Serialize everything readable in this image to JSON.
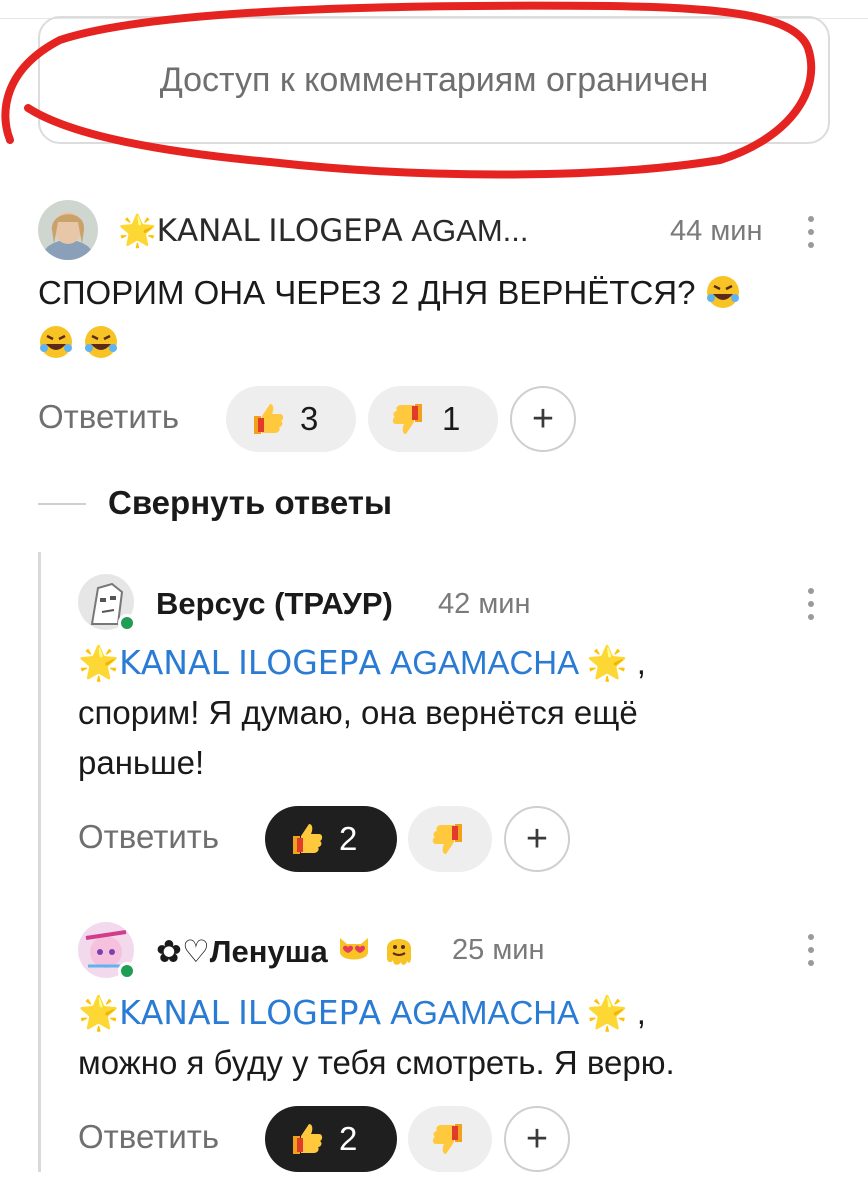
{
  "restricted_notice": "Доступ к комментариям ограничен",
  "actions": {
    "reply_label": "Ответить",
    "collapse_label": "Свернуть ответы",
    "plus": "+"
  },
  "comments": [
    {
      "author_star": "🌟",
      "author": "ꓗꓮꓠꓮꓡ ꓲꓡꓳꓖꓰꓑꓮ AGAM...",
      "time": "44 мин",
      "text": "СПОРИМ ОНА ЧЕРЕЗ 2 ДНЯ ВЕРНЁТСЯ?",
      "text_emoji": [
        "rofl-emoji",
        "rofl-emoji",
        "rofl-emoji"
      ],
      "likes": "3",
      "dislikes": "1"
    },
    {
      "author": "Версус (ТРАУР)",
      "time": "42 мин",
      "mention": "🌟ꓗꓮꓠꓮꓡ ꓲꓡꓳꓖꓰꓑꓮ AGAMACHA 🌟",
      "text_line1_suffix": " ,",
      "text_line2": "спорим! Я думаю, она вернётся ещё",
      "text_line3": "раньше!",
      "likes": "2",
      "online": true
    },
    {
      "author": "✿♡Ленуша",
      "author_emoji": [
        "heart-eyes-cat-emoji",
        "melting-face-emoji"
      ],
      "time": "25 мин",
      "mention": "🌟ꓗꓮꓠꓮꓡ ꓲꓡꓳꓖꓰꓑꓮ AGAMACHA 🌟",
      "text_line1_suffix": " ,",
      "text_line2": "можно я буду у тебя смотреть. Я верю.",
      "likes": "2",
      "online": true
    }
  ],
  "colors": {
    "annotation": "#e52421",
    "mention": "#2a7bd4",
    "online": "#1f9d55"
  }
}
